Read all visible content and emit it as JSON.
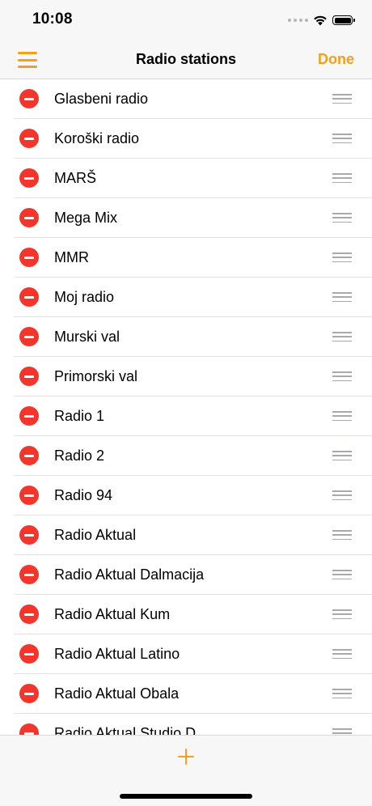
{
  "status_bar": {
    "time": "10:08",
    "icons": [
      "cellular-dots-icon",
      "wifi-icon",
      "battery-icon"
    ]
  },
  "nav_bar": {
    "menu_icon": "hamburger-menu-icon",
    "title": "Radio stations",
    "done_label": "Done"
  },
  "colors": {
    "accent": "#f5a01a",
    "delete": "#f4352b",
    "separator": "#e2e2e2",
    "bar_background": "#f7f7f7"
  },
  "stations": [
    {
      "name": "Glasbeni radio"
    },
    {
      "name": "Koroški radio"
    },
    {
      "name": "MARŠ"
    },
    {
      "name": "Mega Mix"
    },
    {
      "name": "MMR"
    },
    {
      "name": "Moj radio"
    },
    {
      "name": "Murski val"
    },
    {
      "name": "Primorski val"
    },
    {
      "name": "Radio 1"
    },
    {
      "name": "Radio 2"
    },
    {
      "name": "Radio 94"
    },
    {
      "name": "Radio Aktual"
    },
    {
      "name": "Radio Aktual Dalmacija"
    },
    {
      "name": "Radio Aktual Kum"
    },
    {
      "name": "Radio Aktual Latino"
    },
    {
      "name": "Radio Aktual Obala"
    },
    {
      "name": "Radio Aktual Studio D"
    }
  ],
  "row_icons": {
    "delete": "minus-circle-icon",
    "reorder": "reorder-handle-icon"
  },
  "toolbar": {
    "add_icon": "plus-icon"
  }
}
